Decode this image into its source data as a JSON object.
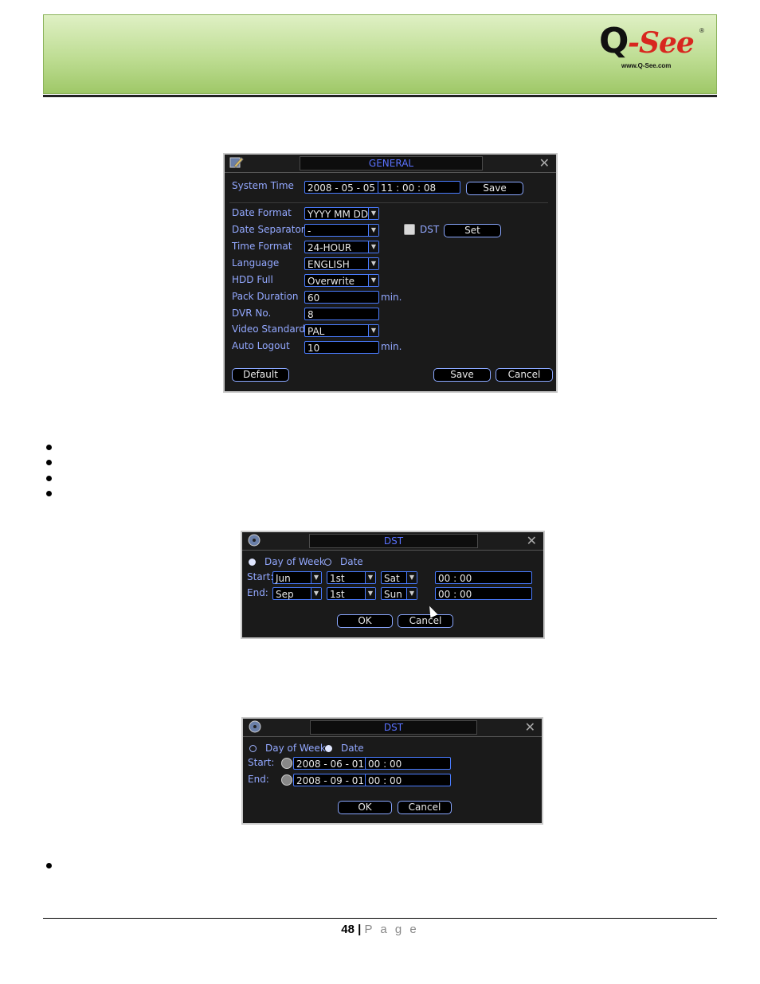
{
  "logo": {
    "mark_q": "Q",
    "mark_see": "-See",
    "reg": "®",
    "url": "www.Q-See.com"
  },
  "general": {
    "title": "GENERAL",
    "system_time_label": "System Time",
    "date_value": "2008  - 05 - 05",
    "time_value": "11 : 00 : 08",
    "save_top": "Save",
    "date_format_label": "Date Format",
    "date_format_value": "YYYY MM DD",
    "date_separator_label": "Date Separator",
    "date_separator_value": "-",
    "dst_label": "DST",
    "set_label": "Set",
    "time_format_label": "Time Format",
    "time_format_value": "24-HOUR",
    "language_label": "Language",
    "language_value": "ENGLISH",
    "hdd_full_label": "HDD Full",
    "hdd_full_value": "Overwrite",
    "pack_duration_label": "Pack Duration",
    "pack_duration_value": "60",
    "min1": "min.",
    "dvr_no_label": "DVR No.",
    "dvr_no_value": "8",
    "video_standard_label": "Video Standard",
    "video_standard_value": "PAL",
    "auto_logout_label": "Auto Logout",
    "auto_logout_value": "10",
    "min2": "min.",
    "default_label": "Default",
    "save_label": "Save",
    "cancel_label": "Cancel"
  },
  "dst_week": {
    "title": "DST",
    "day_of_week": "Day of Week",
    "date": "Date",
    "start_label": "Start:",
    "end_label": "End:",
    "start_month": "Jun",
    "start_week": "1st",
    "start_day": "Sat",
    "start_time": "00  : 00",
    "end_month": "Sep",
    "end_week": "1st",
    "end_day": "Sun",
    "end_time": "00  : 00",
    "ok_label": "OK",
    "cancel_label": "Cancel"
  },
  "dst_date": {
    "title": "DST",
    "day_of_week": "Day of Week",
    "date": "Date",
    "start_label": "Start:",
    "end_label": "End:",
    "start_date": "2008  - 06 - 01",
    "start_time": "00 : 00",
    "end_date": "2008  - 09 - 01",
    "end_time": "00 : 00",
    "ok_label": "OK",
    "cancel_label": "Cancel"
  },
  "footer": {
    "page_number": "48",
    "separator": "|",
    "page_word": "P a g e"
  }
}
